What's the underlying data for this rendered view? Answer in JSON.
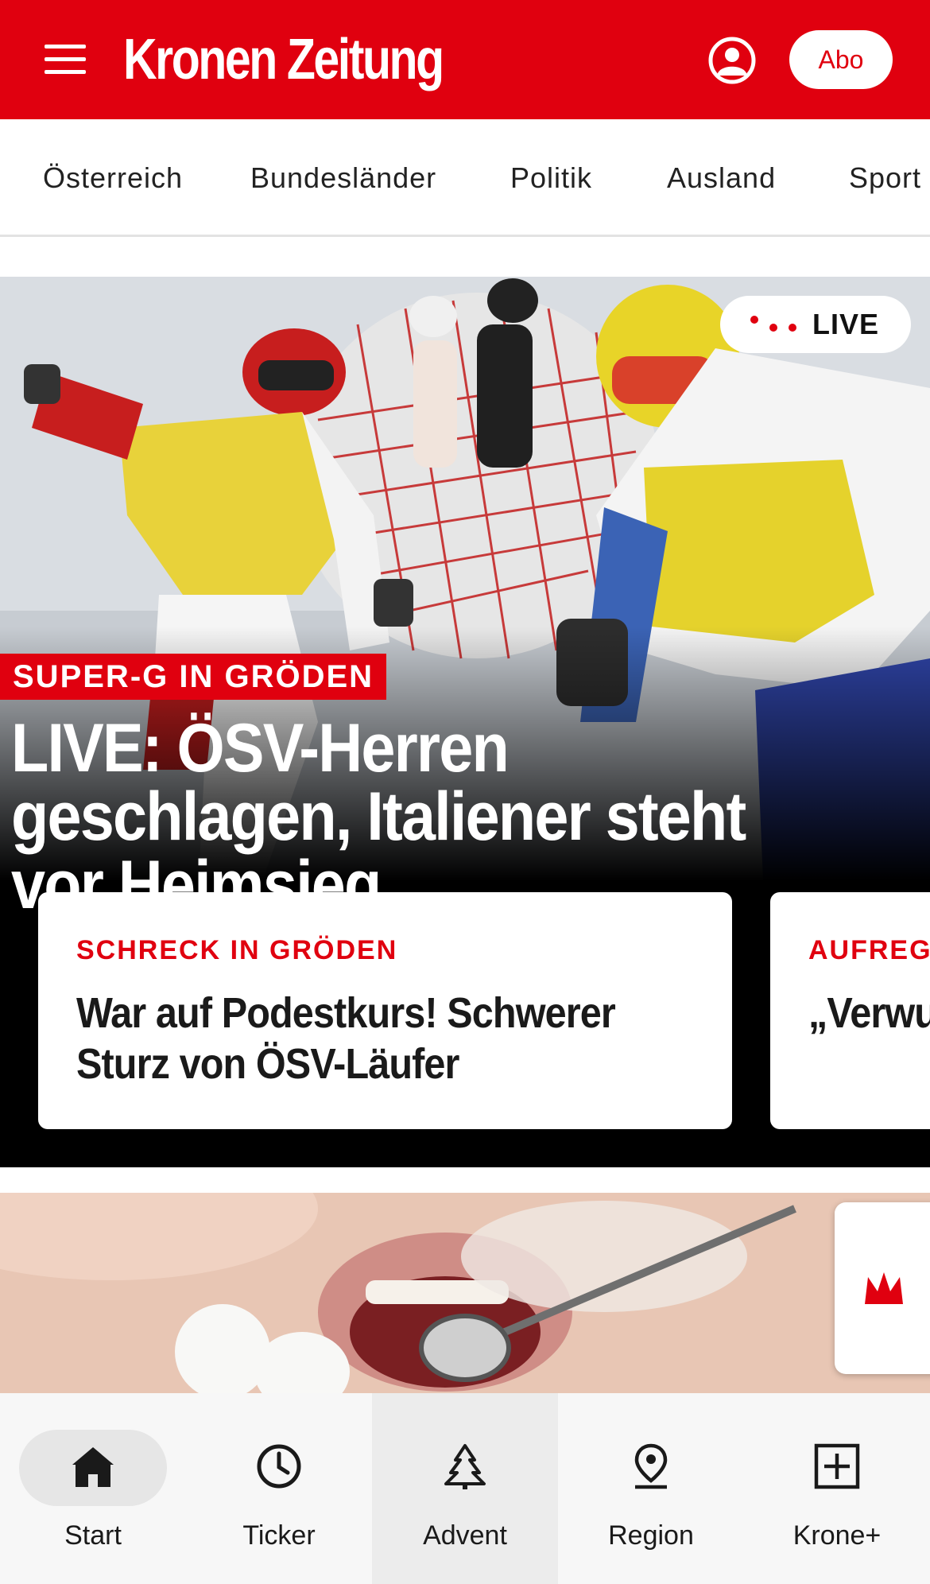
{
  "header": {
    "logo_text": "Kronen Zeitung",
    "abo_label": "Abo",
    "brand_color": "#e0000f"
  },
  "categories": [
    "Österreich",
    "Bundesländer",
    "Politik",
    "Ausland",
    "Sport"
  ],
  "hero": {
    "live_label": "LIVE",
    "kicker": "SUPER-G IN GRÖDEN",
    "headline": "LIVE: ÖSV-Herren geschlagen, Italiener steht vor Heimsieg"
  },
  "cards": [
    {
      "kicker": "SCHRECK IN GRÖDEN",
      "title": "War auf Podestkurs! Schwerer Sturz von ÖSV-Läufer"
    },
    {
      "kicker": "AUFREGU",
      "title": "„Verwu Skifah"
    }
  ],
  "bottom_nav": [
    {
      "label": "Start",
      "icon": "home-icon",
      "active": true
    },
    {
      "label": "Ticker",
      "icon": "clock-icon",
      "active": false
    },
    {
      "label": "Advent",
      "icon": "tree-icon",
      "active": false
    },
    {
      "label": "Region",
      "icon": "location-pin-icon",
      "active": false
    },
    {
      "label": "Krone+",
      "icon": "plus-box-icon",
      "active": false
    }
  ]
}
